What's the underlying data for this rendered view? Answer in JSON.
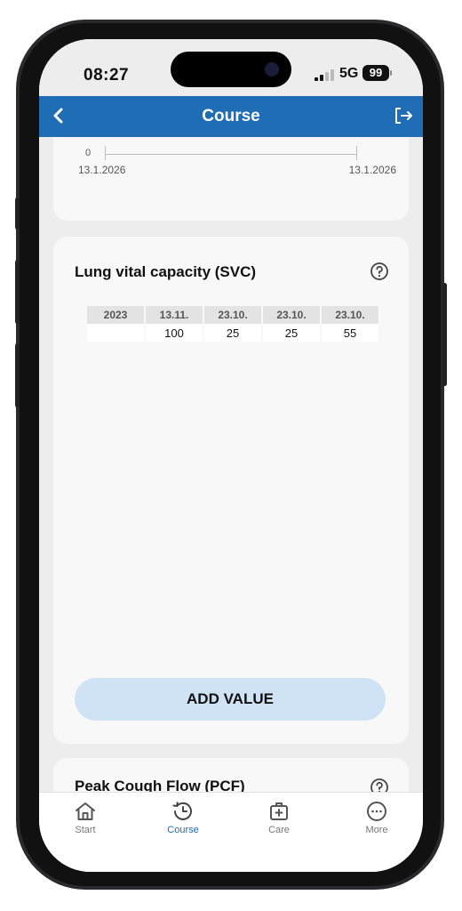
{
  "status": {
    "time": "08:27",
    "network": "5G",
    "battery": "99"
  },
  "nav": {
    "title": "Course"
  },
  "top_chart": {
    "y_zero": "0",
    "date_start": "13.1.2026",
    "date_end": "13.1.2026"
  },
  "svc": {
    "title": "Lung vital capacity (SVC)",
    "headers": [
      "2023",
      "13.11.",
      "23.10.",
      "23.10.",
      "23.10."
    ],
    "values": [
      "",
      "100",
      "25",
      "25",
      "55"
    ],
    "add_button": "ADD VALUE"
  },
  "pcf": {
    "title": "Peak Cough Flow (PCF)"
  },
  "tabs": [
    {
      "label": "Start",
      "icon": "home-icon"
    },
    {
      "label": "Course",
      "icon": "history-icon"
    },
    {
      "label": "Care",
      "icon": "medical-kit-icon"
    },
    {
      "label": "More",
      "icon": "more-icon"
    }
  ],
  "colors": {
    "primary": "#1e6db5",
    "button_bg": "#cfe3f5",
    "background": "#ededed"
  }
}
